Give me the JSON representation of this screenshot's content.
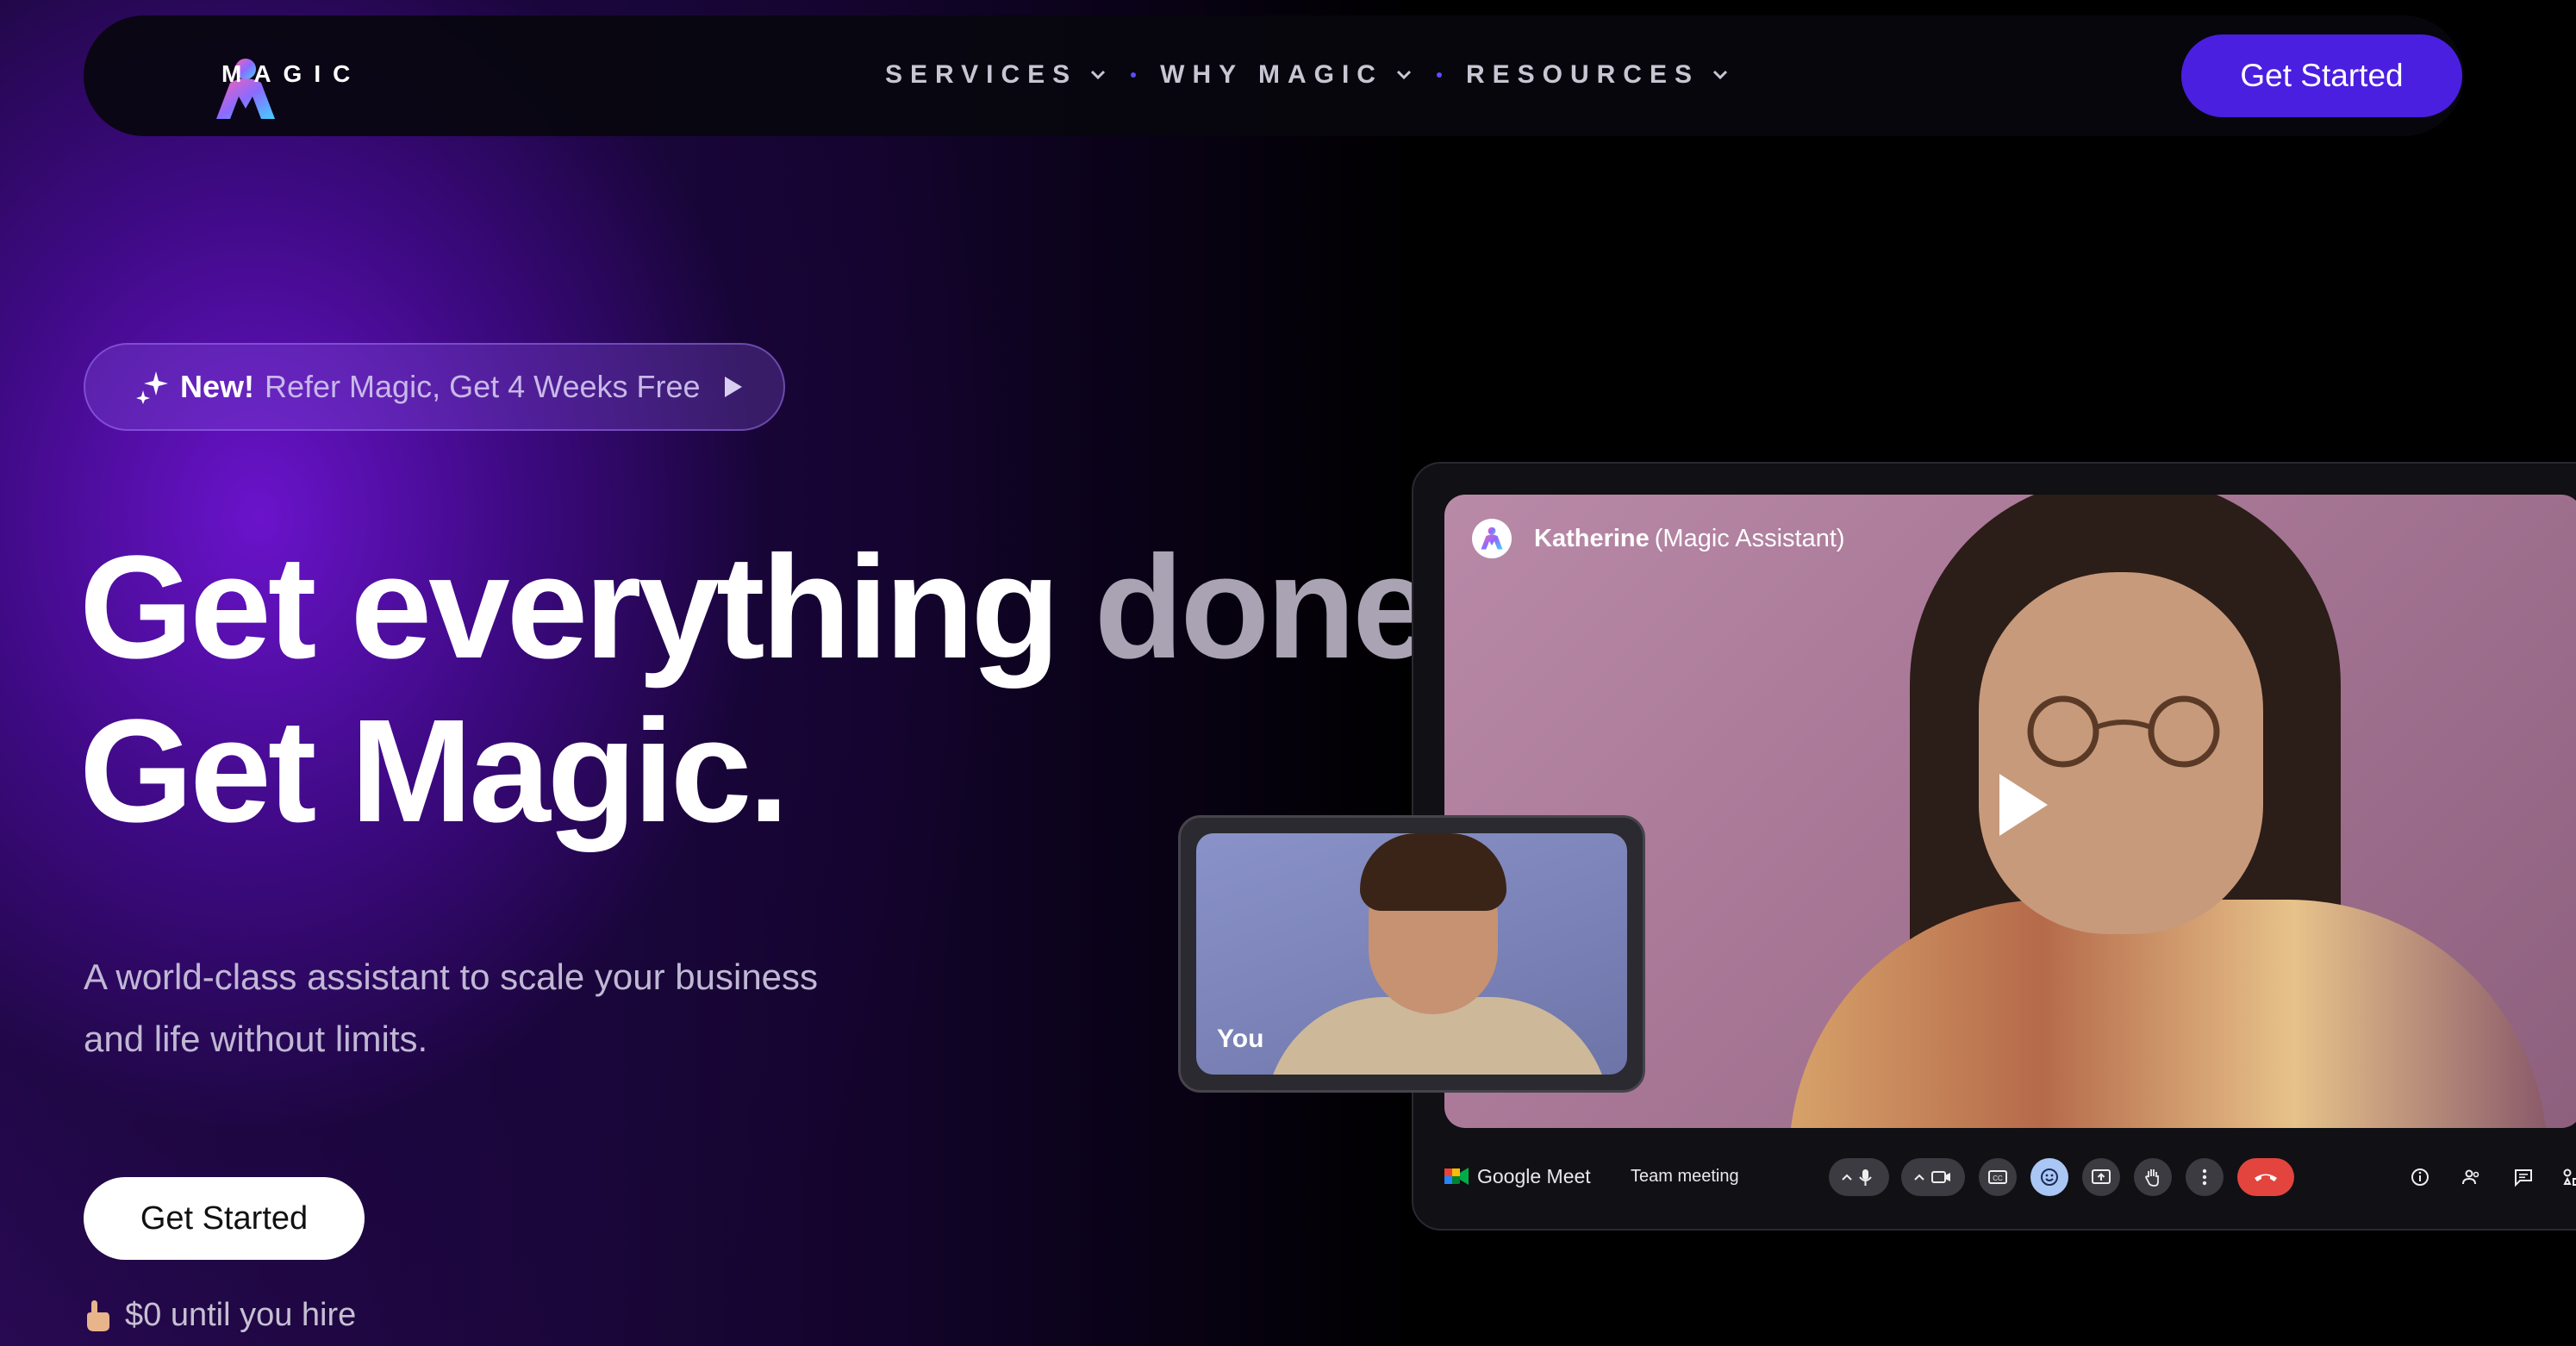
{
  "nav": {
    "brand": "MAGIC",
    "links": [
      {
        "label": "SERVICES"
      },
      {
        "label": "WHY MAGIC"
      },
      {
        "label": "RESOURCES"
      }
    ],
    "cta": "Get Started"
  },
  "promo": {
    "badge": "New!",
    "text": "Refer Magic, Get 4 Weeks Free"
  },
  "hero": {
    "line1_bright": "Get everything",
    "line1_dim": "done.",
    "line2": "Get Magic.",
    "subtitle_line1": "A world-class assistant to scale your business",
    "subtitle_line2": "and life without limits.",
    "cta": "Get Started",
    "note": "$0 until you hire"
  },
  "meet": {
    "speaker_name": "Katherine",
    "speaker_role": "(Magic Assistant)",
    "self_label": "You",
    "app_name": "Google Meet",
    "meeting_title": "Team meeting"
  },
  "colors": {
    "accent": "#4a1fe0",
    "hero_glow": "#6e14d2",
    "end_call": "#e3443e"
  },
  "icons": [
    "magic-logo-icon",
    "chevron-down-icon",
    "sparkle-icon",
    "play-icon",
    "pointing-hand-icon",
    "google-meet-icon",
    "microphone-icon",
    "camera-icon",
    "captions-icon",
    "emoji-icon",
    "present-icon",
    "raise-hand-icon",
    "more-icon",
    "end-call-icon",
    "info-icon",
    "people-icon",
    "chat-icon",
    "activities-icon"
  ]
}
